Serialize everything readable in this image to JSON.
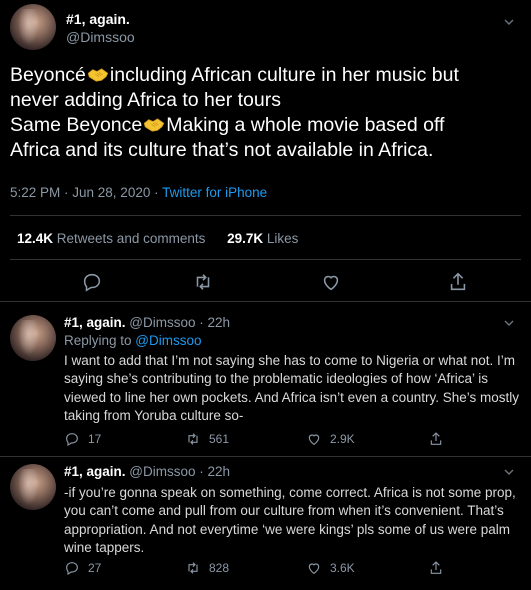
{
  "main_tweet": {
    "author_name": "#1, again.",
    "author_handle": "@Dimssoo",
    "text_line1_a": "Beyoncé",
    "text_line1_b": "including African culture in her music but",
    "text_line2": "never adding Africa to her tours",
    "text_line3_a": "Same Beyonce",
    "text_line3_b": "Making a whole movie based off",
    "text_line4": "Africa and its culture that’s not available in Africa.",
    "time": "5:22 PM · Jun 28, 2020 · ",
    "source": "Twitter for iPhone",
    "retweets_count": "12.4K",
    "retweets_label": " Retweets and comments",
    "likes_count": "29.7K",
    "likes_label": " Likes"
  },
  "replies": [
    {
      "author_name": "#1, again.",
      "handle_time": " @Dimssoo · 22h",
      "replying_prefix": "Replying to ",
      "replying_to": "@Dimssoo",
      "text": "I want to add that I’m not saying she has to come to Nigeria or what not. I’m saying she’s contributing to the problematic ideologies of how ‘Africa’ is viewed to line her own pockets. And Africa isn’t even a country. She’s mostly taking from Yoruba culture so-",
      "reply_count": "17",
      "retweet_count": "561",
      "like_count": "2.9K"
    },
    {
      "author_name": "#1, again.",
      "handle_time": " @Dimssoo · 22h",
      "text": "-if you’re gonna speak on something, come correct. Africa is not some prop, you can’t come and pull from our culture from when it’s convenient. That’s appropriation. And not everytime ‘we were kings’ pls some of us were palm wine tappers.",
      "reply_count": "27",
      "retweet_count": "828",
      "like_count": "3.6K"
    }
  ],
  "colors": {
    "background": "#000000",
    "accent": "#1d9bf0",
    "muted": "#8b98a5",
    "border": "#2f3336",
    "emoji": "#f4c430"
  },
  "icons": [
    "more-icon",
    "reply-icon",
    "retweet-icon",
    "like-icon",
    "share-icon",
    "handshake-emoji"
  ]
}
